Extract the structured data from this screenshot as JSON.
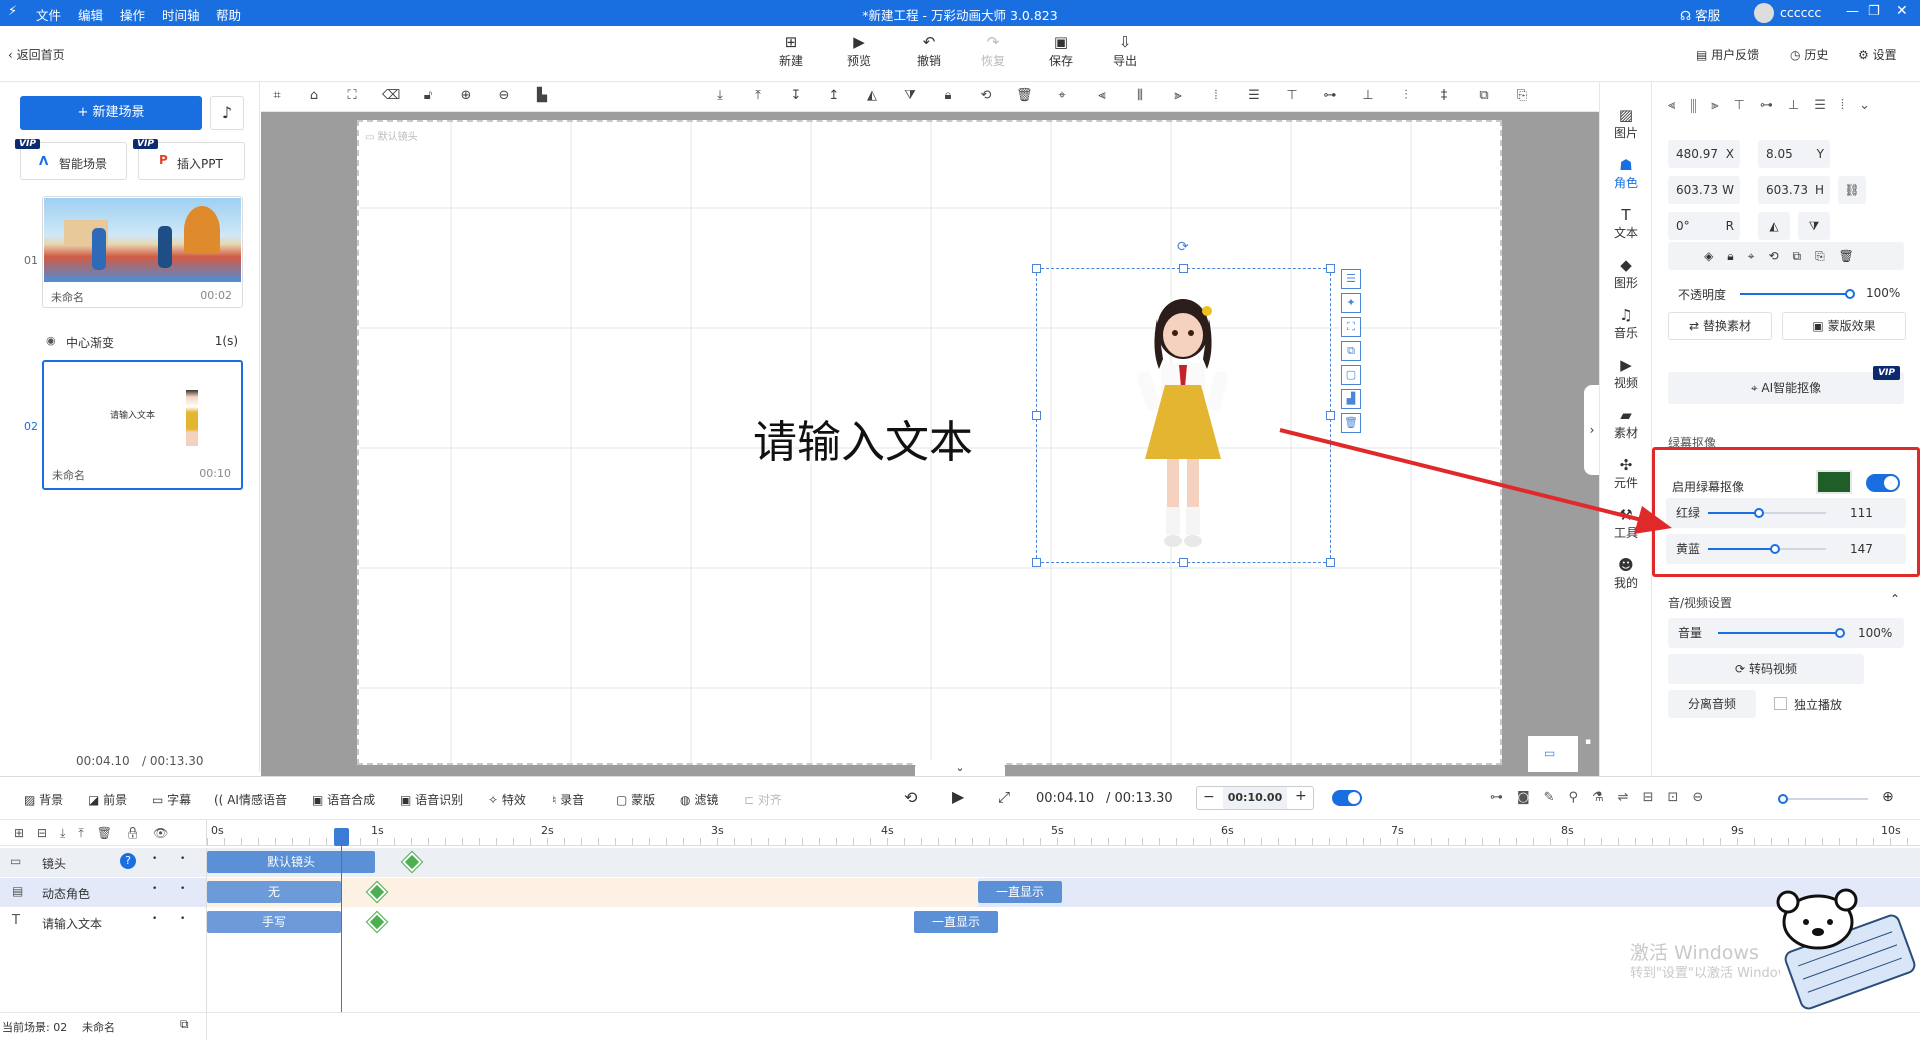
{
  "titlebar": {
    "menus": [
      "文件",
      "编辑",
      "操作",
      "时间轴",
      "帮助"
    ],
    "title": "*新建工程 - 万彩动画大师 3.0.823",
    "support": "客服",
    "username": "cccccc"
  },
  "toolbar": {
    "back": "返回首页",
    "buttons": [
      "新建",
      "预览",
      "撤销",
      "恢复",
      "保存",
      "导出"
    ],
    "right": [
      "用户反馈",
      "历史",
      "设置"
    ]
  },
  "scenes": {
    "new_scene": "+ 新建场景",
    "smart_scene": "智能场景",
    "insert_ppt": "插入PPT",
    "vip": "VIP",
    "items": [
      {
        "index": "01",
        "name": "未命名",
        "duration": "00:02"
      },
      {
        "index": "02",
        "name": "未命名",
        "duration": "00:10",
        "thumb_text": "请输入文本"
      }
    ],
    "transition": {
      "name": "中心渐变",
      "duration": "1(s)"
    },
    "time_current": "00:04.10",
    "time_total": "/ 00:13.30"
  },
  "canvas": {
    "camera_label": "默认镜头",
    "text": "请输入文本"
  },
  "rstrip": [
    "图片",
    "角色",
    "文本",
    "图形",
    "音乐",
    "视频",
    "素材",
    "元件",
    "工具",
    "我的"
  ],
  "props": {
    "x_value": "480.97",
    "x_label": "X",
    "y_value": "8.05",
    "y_label": "Y",
    "w_value": "603.73",
    "w_label": "W",
    "h_value": "603.73",
    "h_label": "H",
    "r_value": "0°",
    "r_label": "R",
    "opacity_label": "不透明度",
    "opacity_value": "100%",
    "opacity_level": 1.0,
    "replace": "替换素材",
    "mask_effect": "蒙版效果",
    "ai_cutout": "AI智能抠像",
    "vip": "VIP",
    "greenscreen_section": "绿幕抠像",
    "enable_greenscreen": "启用绿幕抠像",
    "greenscreen_color": "#1f5e27",
    "greenscreen_enabled": true,
    "red_green_label": "红绿",
    "red_green_value": "111",
    "red_green_level": 0.43,
    "yellow_blue_label": "黄蓝",
    "yellow_blue_value": "147",
    "yellow_blue_level": 0.57,
    "av_section": "音/视频设置",
    "volume_label": "音量",
    "volume_value": "100%",
    "volume_level": 1.0,
    "transcode": "转码视频",
    "separate_audio": "分离音频",
    "independent_play": "独立播放"
  },
  "timeline": {
    "tools": [
      "背景",
      "前景",
      "字幕",
      "AI情感语音",
      "语音合成",
      "语音识别",
      "特效",
      "录音",
      "蒙版",
      "滤镜",
      "对齐"
    ],
    "time_current": "00:04.10",
    "time_total": "/ 00:13.30",
    "duration_value": "00:10.00",
    "ruler": [
      "0s",
      "1s",
      "2s",
      "3s",
      "4s",
      "5s",
      "6s",
      "7s",
      "8s",
      "9s",
      "10s"
    ],
    "tracks": [
      {
        "name": "镜头",
        "clip": "默认镜头",
        "mid_clip": ""
      },
      {
        "name": "动态角色",
        "clip": "无",
        "mid_clip": "一直显示"
      },
      {
        "name": "请输入文本",
        "clip": "手写",
        "mid_clip": "一直显示"
      }
    ]
  },
  "status": {
    "label": "当前场景: 02",
    "name": "未命名"
  },
  "watermark": {
    "title": "激活 Windows",
    "sub": "转到\"设置\"以激活 Windows。"
  }
}
